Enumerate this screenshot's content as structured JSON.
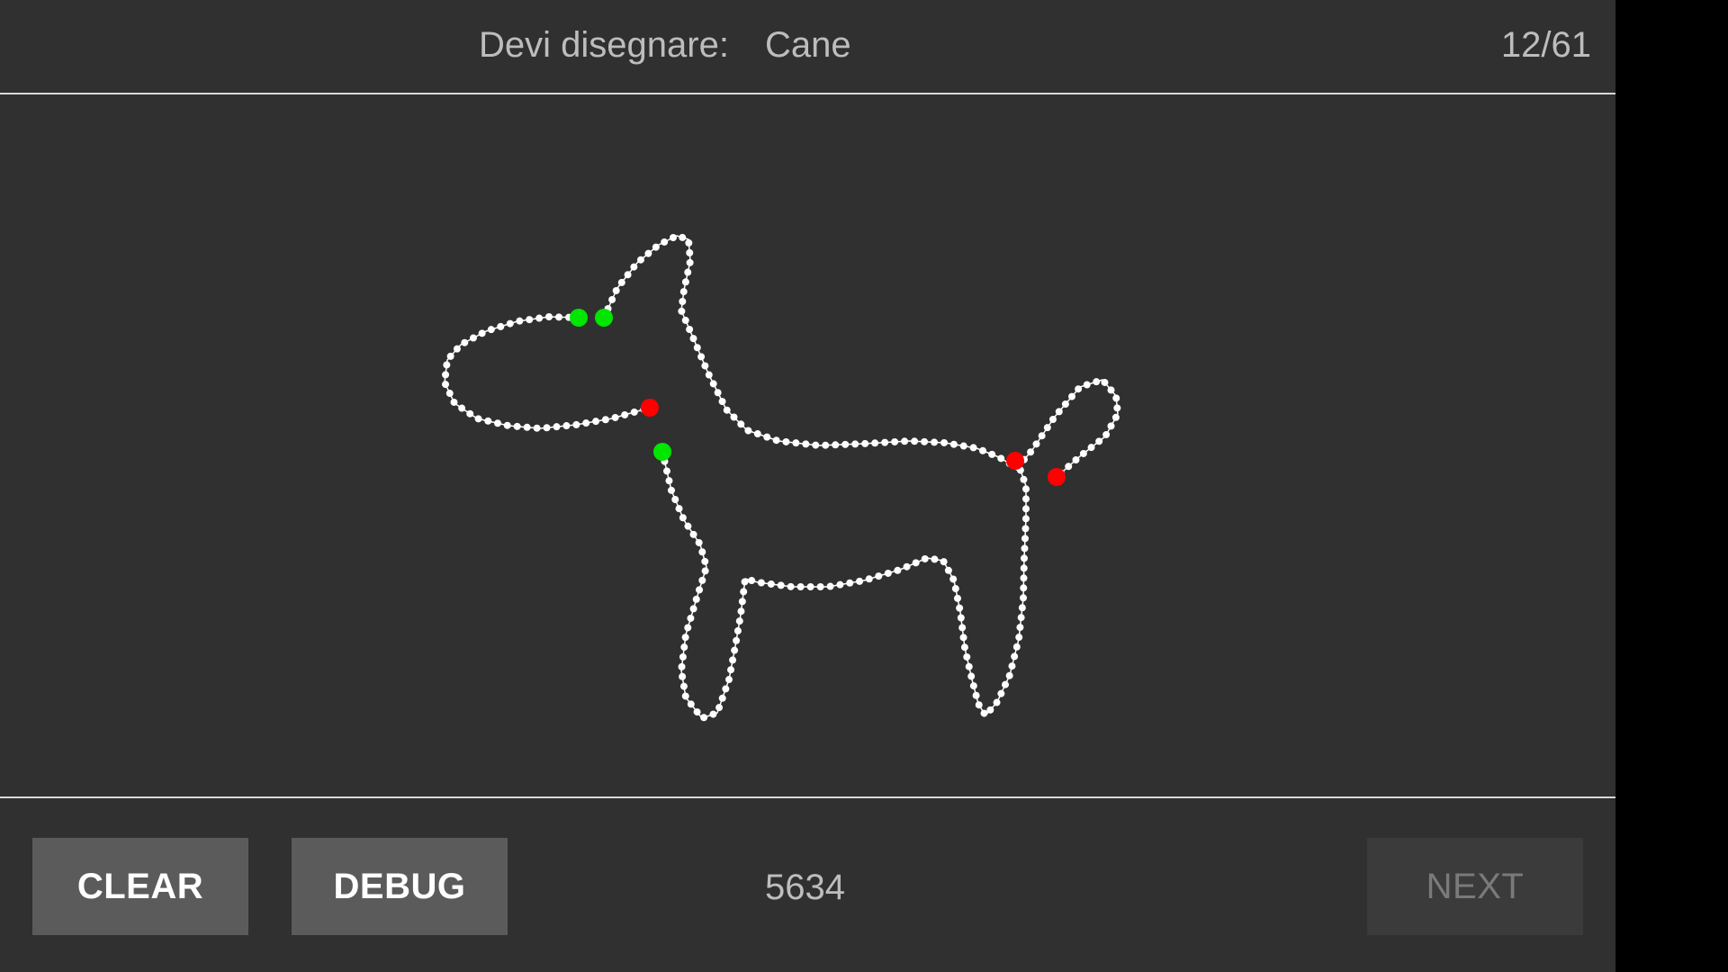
{
  "header": {
    "prompt_label": "Devi disegnare:",
    "prompt_word": "Cane",
    "progress": "12/61"
  },
  "footer": {
    "clear_label": "CLEAR",
    "debug_label": "DEBUG",
    "score": "5634",
    "next_label": "NEXT",
    "next_enabled": false
  },
  "drawing": {
    "subject": "dog",
    "point_color": "#ffffff",
    "stroke_start_color": "#00e600",
    "stroke_end_color": "#ff0000",
    "stroke_count": 3
  },
  "colors": {
    "background": "#303030",
    "divider": "#d8d8d8",
    "button_bg": "#5b5b5c",
    "button_disabled_bg": "#3b3b3b",
    "text": "#bdbdbd"
  }
}
